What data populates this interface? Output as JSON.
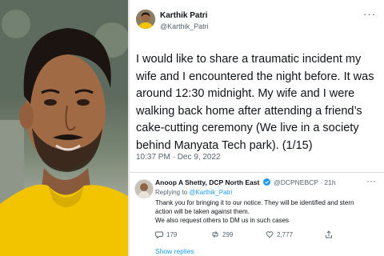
{
  "tweet": {
    "author_name": "Karthik Patri",
    "author_handle": "@Karthik_Patri",
    "text": "I would like to share a traumatic incident my wife and I encountered the night before. It was around 12:30 midnight. My wife and I were walking back home after attending a friend’s cake-cutting ceremony (We live in a society behind Manyata Tech park). (1/15)",
    "timestamp": "10:37 PM · Dec 9, 2022",
    "more_glyph": "···"
  },
  "reply": {
    "author_name": "Anoop A Shetty, DCP North East",
    "author_handle": "@DCPNEBCP",
    "time": "· 21h",
    "replying_prefix": "Replying to",
    "replying_to": "@Karthik_Patri",
    "body_line1": "Thank you for bringing it to our notice. They will be identified and stern action will be taken against them.",
    "body_line2": "We also request others to DM us in such cases",
    "more_glyph": "···",
    "counts": {
      "replies": "179",
      "retweets": "299",
      "likes": "2,777"
    },
    "show_replies": "Show replies"
  },
  "colors": {
    "accent": "#1d9bf0",
    "text": "#0f1419",
    "muted": "#536471",
    "shirt": "#f2c400"
  }
}
